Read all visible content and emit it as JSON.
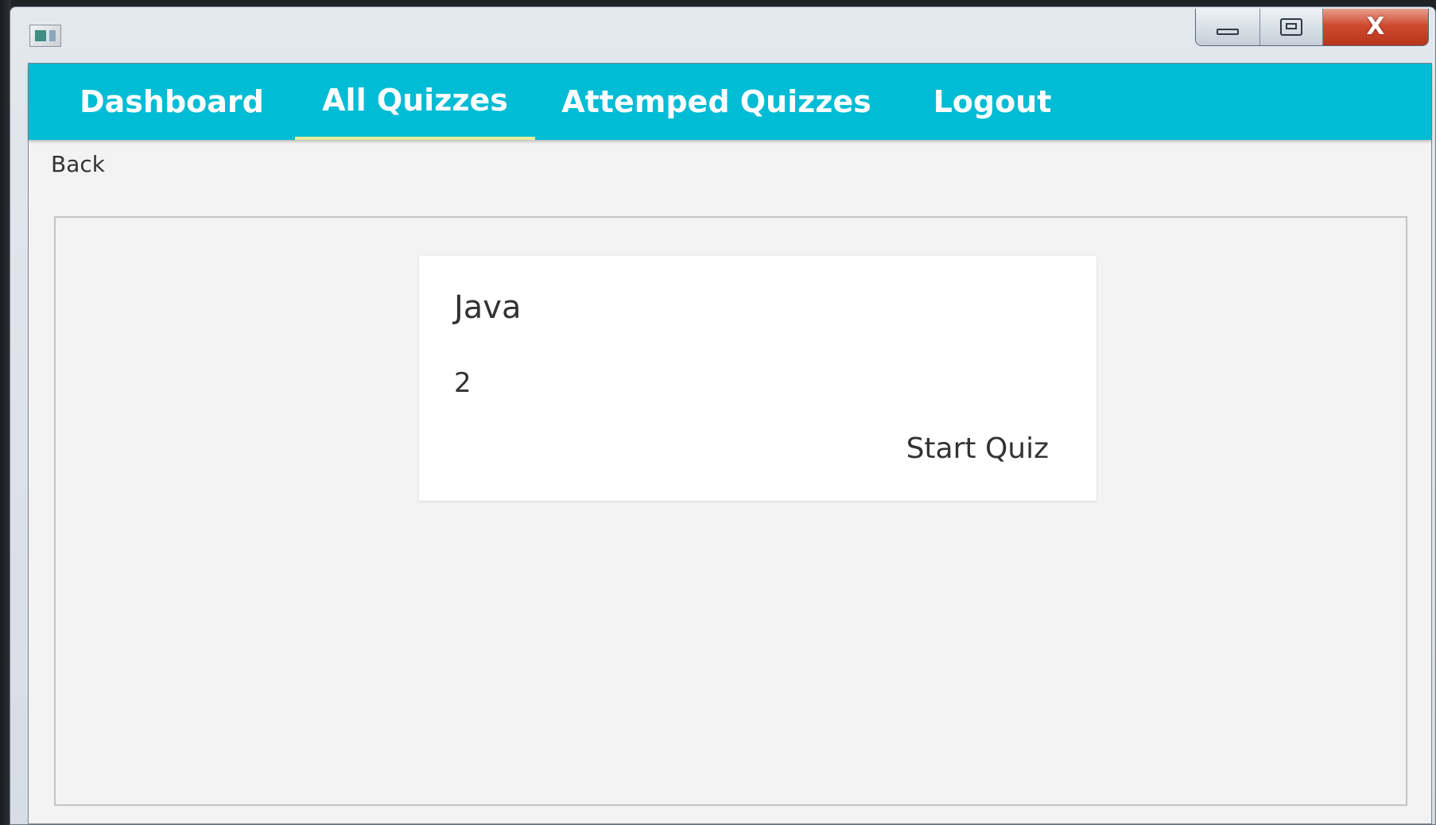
{
  "window": {
    "controls": {
      "minimize_icon": "minimize-icon",
      "maximize_icon": "maximize-icon",
      "close_icon": "close-icon",
      "close_glyph": "X"
    }
  },
  "navbar": {
    "color": "#00bcd4",
    "active_indicator_color": "#e6ee9c",
    "tabs": [
      {
        "label": "Dashboard",
        "active": false
      },
      {
        "label": "All Quizzes",
        "active": true
      },
      {
        "label": "Attemped Quizzes",
        "active": false
      },
      {
        "label": "Logout",
        "active": false
      }
    ]
  },
  "back": {
    "label": "Back"
  },
  "quiz_card": {
    "title": "Java",
    "count": "2",
    "action_label": "Start Quiz"
  }
}
